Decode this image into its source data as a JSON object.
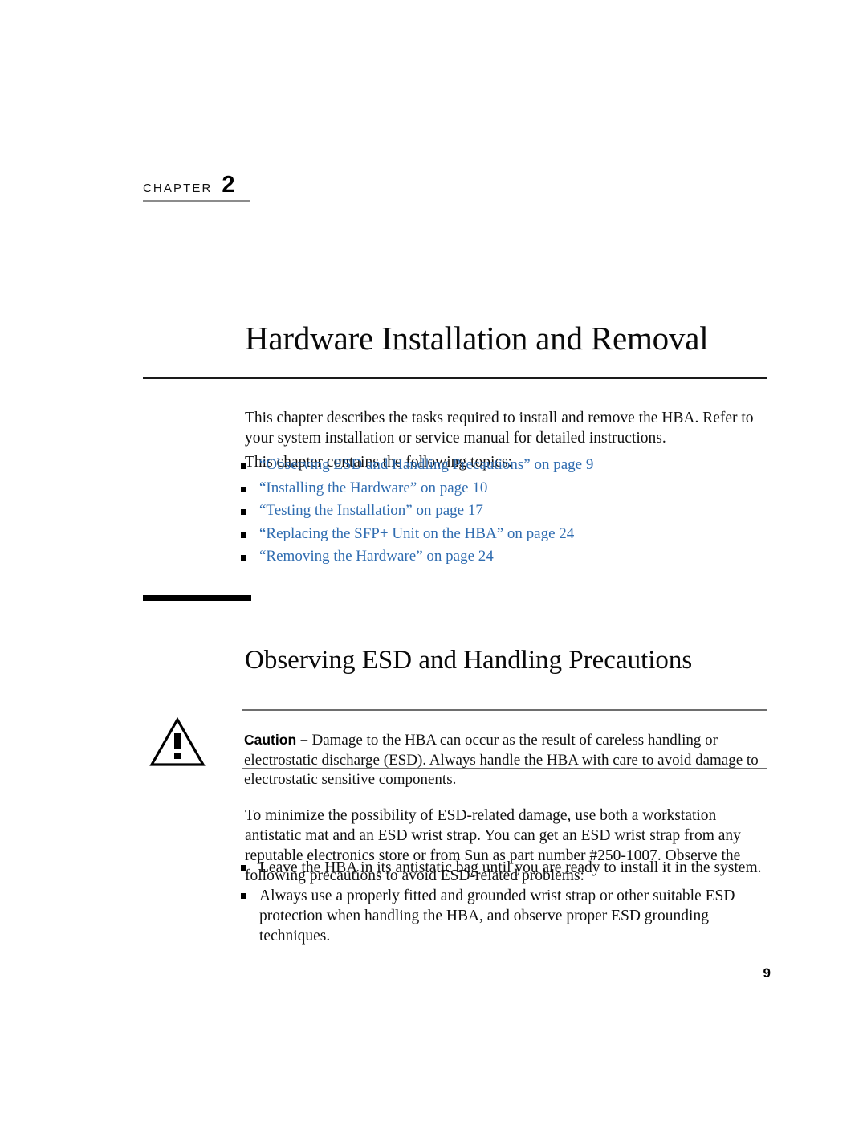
{
  "chapter": {
    "label": "CHAPTER",
    "number": "2",
    "title": "Hardware Installation and Removal"
  },
  "intro": {
    "paragraph_1": "This chapter describes the tasks required to install and remove the HBA. Refer to your system installation or service manual for detailed instructions.",
    "paragraph_2": "This chapter contains the following topics:"
  },
  "topics": [
    {
      "text": "“Observing ESD and Handling Precautions” on page 9"
    },
    {
      "text": "“Installing the Hardware” on page 10"
    },
    {
      "text": "“Testing the Installation” on page 17"
    },
    {
      "text": "“Replacing the SFP+ Unit on the HBA” on page 24"
    },
    {
      "text": "“Removing the Hardware” on page 24"
    }
  ],
  "section": {
    "heading": "Observing ESD and Handling Precautions"
  },
  "caution": {
    "label": "Caution –",
    "text": " Damage to the HBA can occur as the result of careless handling or electrostatic discharge (ESD). Always handle the HBA with care to avoid damage to electrostatic sensitive components.",
    "icon": "warning-triangle-icon"
  },
  "body": {
    "paragraph": "To minimize the possibility of ESD-related damage, use both a workstation antistatic mat and an ESD wrist strap. You can get an ESD wrist strap from any reputable electronics store or from Sun as part number #250-1007. Observe the following precautions to avoid ESD-related problems:"
  },
  "precautions": [
    {
      "text": "Leave the HBA in its antistatic bag until you are ready to install it in the system."
    },
    {
      "text": "Always use a properly fitted and grounded wrist strap or other suitable ESD protection when handling the HBA, and observe proper ESD grounding techniques."
    }
  ],
  "footer": {
    "page_number": "9"
  },
  "colors": {
    "link": "#2f6cb0",
    "rule_dark": "#1a1a1a",
    "rule_gray": "#6e6e6e",
    "text": "#111111"
  }
}
